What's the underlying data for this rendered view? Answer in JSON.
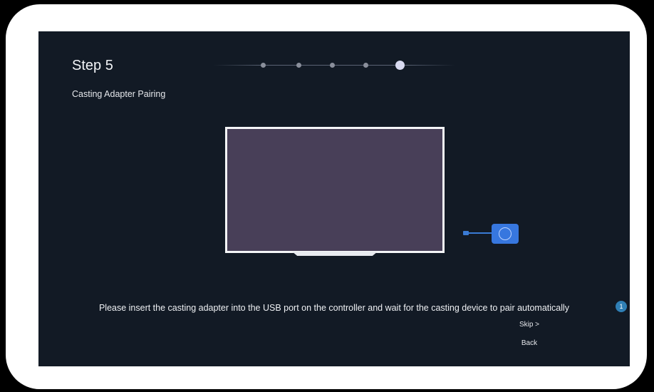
{
  "header": {
    "step_title": "Step 5",
    "subtitle": "Casting Adapter Pairing"
  },
  "progress": {
    "total_steps": 5,
    "current_step": 5
  },
  "instruction": "Please insert the casting adapter into the USB port on the controller and wait for the casting device to pair automatically",
  "badge": {
    "count": "1",
    "color": "#2f7fb5"
  },
  "actions": {
    "skip_label": "Skip >",
    "back_label": "Back"
  },
  "colors": {
    "screen_background": "#121a25",
    "tv_screen": "#483f58",
    "adapter": "#3777df"
  },
  "icons": {
    "tv": "tv-icon",
    "adapter": "casting-adapter-icon"
  }
}
